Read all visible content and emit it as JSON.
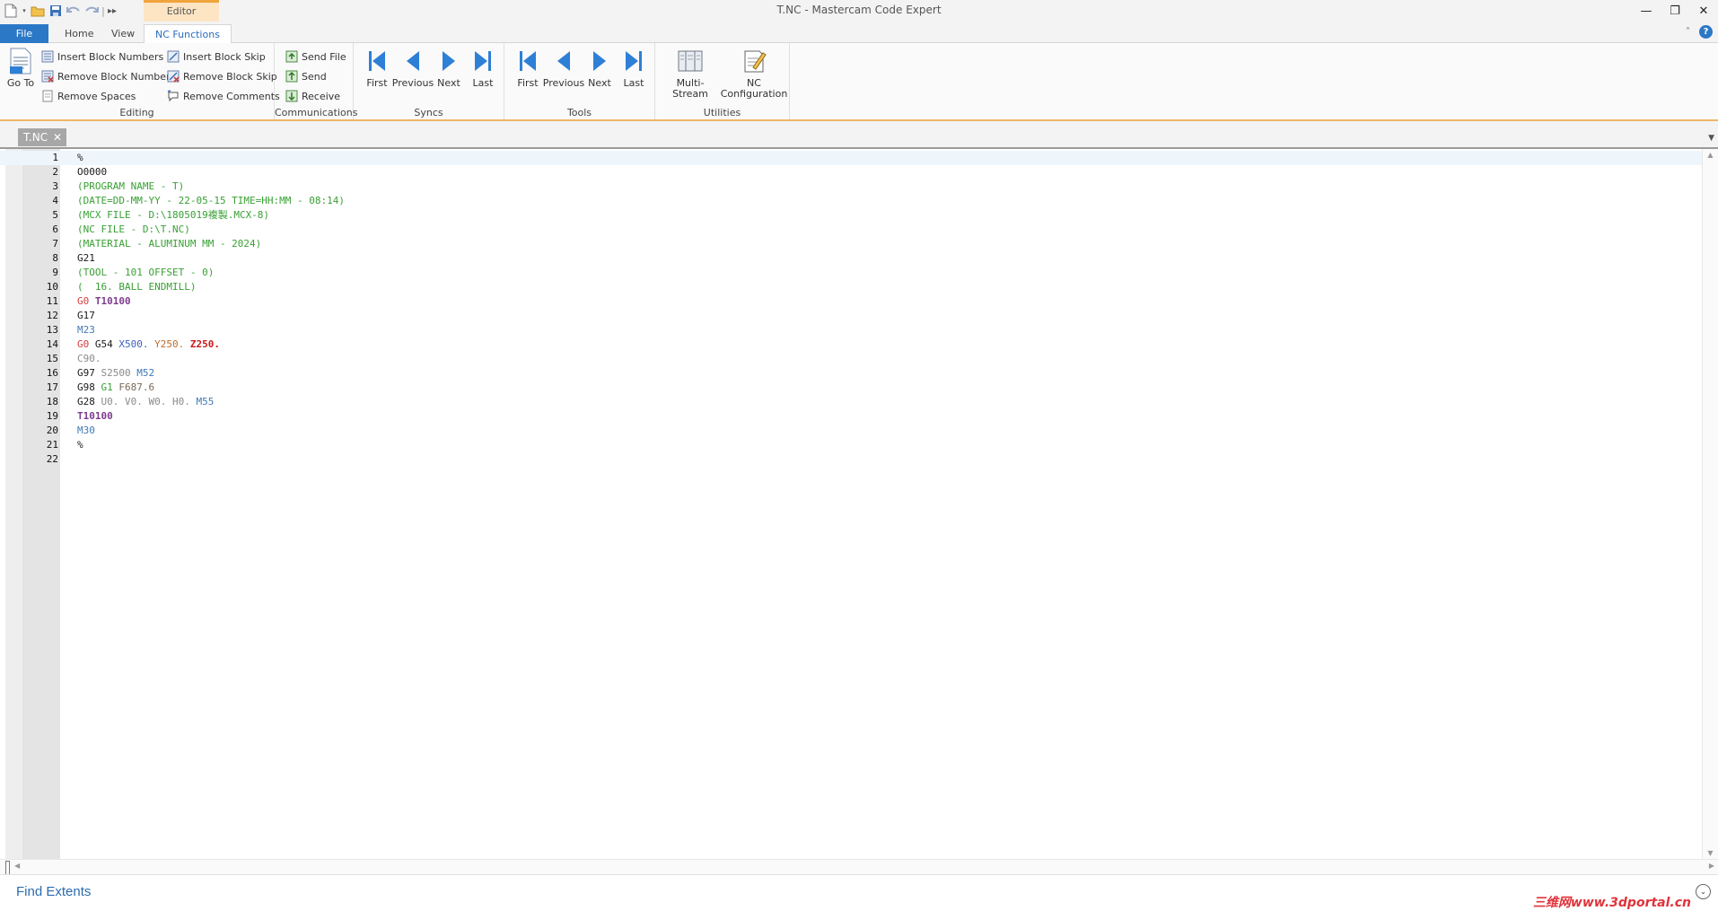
{
  "window": {
    "title": "T.NC - Mastercam Code Expert",
    "context_tab": "Editor"
  },
  "tabs": [
    "File",
    "Home",
    "View",
    "NC Functions"
  ],
  "active_tab": "NC Functions",
  "ribbon": {
    "editing": {
      "label": "Editing",
      "go_to": "Go To",
      "insert_block_numbers": "Insert Block Numbers",
      "remove_block_numbers": "Remove Block Numbers",
      "remove_spaces": "Remove Spaces",
      "insert_block_skip": "Insert Block Skip",
      "remove_block_skip": "Remove Block Skip",
      "remove_comments": "Remove Comments"
    },
    "communications": {
      "label": "Communications",
      "send_file": "Send File",
      "send": "Send",
      "receive": "Receive"
    },
    "syncs": {
      "label": "Syncs",
      "first": "First",
      "previous": "Previous",
      "next": "Next",
      "last": "Last"
    },
    "tools": {
      "label": "Tools",
      "first": "First",
      "previous": "Previous",
      "next": "Next",
      "last": "Last"
    },
    "utilities": {
      "label": "Utilities",
      "multi_stream": "Multi-Stream",
      "nc_configuration_1": "NC",
      "nc_configuration_2": "Configuration"
    }
  },
  "document_tab": {
    "name": "T.NC",
    "close": "✕"
  },
  "code_lines": [
    {
      "n": "1",
      "tokens": [
        {
          "t": "%",
          "c": ""
        }
      ]
    },
    {
      "n": "2",
      "tokens": [
        {
          "t": "O0000",
          "c": ""
        }
      ]
    },
    {
      "n": "3",
      "tokens": [
        {
          "t": "(PROGRAM NAME - T)",
          "c": "c-cm"
        }
      ]
    },
    {
      "n": "4",
      "tokens": [
        {
          "t": "(DATE=DD-MM-YY - 22-05-15 TIME=HH:MM - 08:14)",
          "c": "c-cm"
        }
      ]
    },
    {
      "n": "5",
      "tokens": [
        {
          "t": "(MCX FILE - D:\\1805019複製.MCX-8)",
          "c": "c-cm"
        }
      ]
    },
    {
      "n": "6",
      "tokens": [
        {
          "t": "(NC FILE - D:\\T.NC)",
          "c": "c-cm"
        }
      ]
    },
    {
      "n": "7",
      "tokens": [
        {
          "t": "(MATERIAL - ALUMINUM MM - 2024)",
          "c": "c-cm"
        }
      ]
    },
    {
      "n": "8",
      "tokens": [
        {
          "t": "G21",
          "c": ""
        }
      ]
    },
    {
      "n": "9",
      "tokens": [
        {
          "t": "(TOOL - 101 OFFSET - 0)",
          "c": "c-cm"
        }
      ]
    },
    {
      "n": "10",
      "tokens": [
        {
          "t": "(  16. BALL ENDMILL)",
          "c": "c-cm"
        }
      ]
    },
    {
      "n": "11",
      "tokens": [
        {
          "t": "G0",
          "c": "c-g0"
        },
        {
          "t": " ",
          "c": ""
        },
        {
          "t": "T10100",
          "c": "c-t"
        }
      ]
    },
    {
      "n": "12",
      "tokens": [
        {
          "t": "G17",
          "c": ""
        }
      ]
    },
    {
      "n": "13",
      "tokens": [
        {
          "t": "M23",
          "c": "c-m"
        }
      ]
    },
    {
      "n": "14",
      "tokens": [
        {
          "t": "G0",
          "c": "c-g0"
        },
        {
          "t": " G54 ",
          "c": ""
        },
        {
          "t": "X500.",
          "c": "c-x"
        },
        {
          "t": " ",
          "c": ""
        },
        {
          "t": "Y250.",
          "c": "c-y"
        },
        {
          "t": " ",
          "c": ""
        },
        {
          "t": "Z250.",
          "c": "c-z"
        }
      ]
    },
    {
      "n": "15",
      "tokens": [
        {
          "t": "C90.",
          "c": "c-s"
        }
      ]
    },
    {
      "n": "16",
      "tokens": [
        {
          "t": "G97 ",
          "c": ""
        },
        {
          "t": "S2500",
          "c": "c-s"
        },
        {
          "t": " ",
          "c": ""
        },
        {
          "t": "M52",
          "c": "c-m"
        }
      ]
    },
    {
      "n": "17",
      "tokens": [
        {
          "t": "G98 ",
          "c": ""
        },
        {
          "t": "G1",
          "c": "c-g1"
        },
        {
          "t": " ",
          "c": ""
        },
        {
          "t": "F687.6",
          "c": "c-f"
        }
      ]
    },
    {
      "n": "18",
      "tokens": [
        {
          "t": "G28 ",
          "c": ""
        },
        {
          "t": "U0. V0. W0. H0.",
          "c": "c-s"
        },
        {
          "t": " ",
          "c": ""
        },
        {
          "t": "M55",
          "c": "c-m"
        }
      ]
    },
    {
      "n": "19",
      "tokens": [
        {
          "t": "T10100",
          "c": "c-t"
        }
      ]
    },
    {
      "n": "20",
      "tokens": [
        {
          "t": "M30",
          "c": "c-m"
        }
      ]
    },
    {
      "n": "21",
      "tokens": [
        {
          "t": "%",
          "c": ""
        }
      ]
    },
    {
      "n": "22",
      "tokens": []
    }
  ],
  "status": {
    "find_extents": "Find Extents",
    "watermark": "三维网www.3dportal.cn"
  },
  "colors": {
    "file_tab": "#2b78c7",
    "active_tab_text": "#2a6cbf",
    "context_tab": "#fde5c4",
    "nav_arrow": "#2e7fd6",
    "comment": "#39a034"
  }
}
